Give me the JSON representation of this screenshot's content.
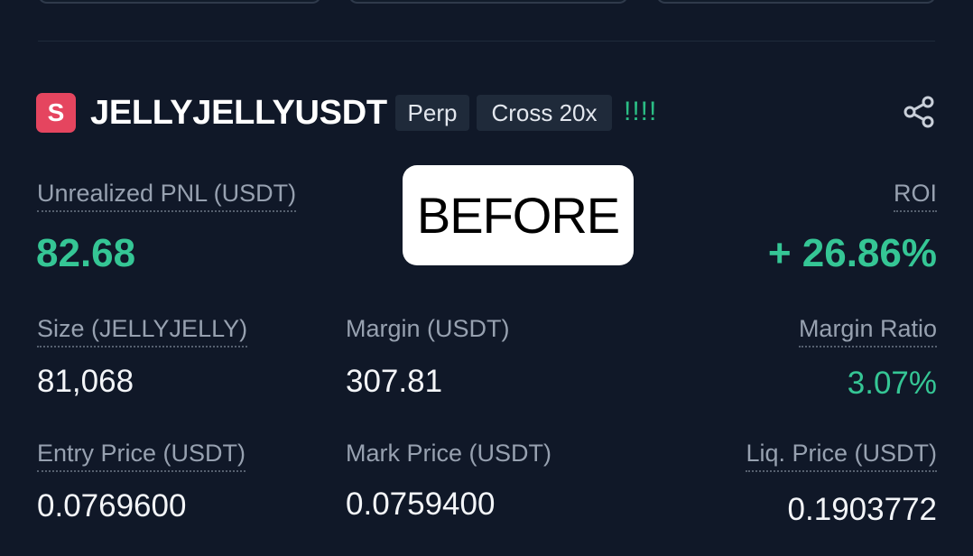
{
  "position": {
    "coin_icon_letter": "S",
    "symbol": "JELLYJELLYUSDT",
    "tags": [
      "Perp",
      "Cross 20x"
    ],
    "risk_indicator": "!!!!",
    "accent_color": "#35c695",
    "icon_color": "#e5455f"
  },
  "pnl": {
    "label": "Unrealized PNL (USDT)",
    "value": "82.68"
  },
  "roi": {
    "label": "ROI",
    "value": "+ 26.86%"
  },
  "size": {
    "label": "Size (JELLYJELLY)",
    "value": "81,068"
  },
  "margin": {
    "label": "Margin (USDT)",
    "value": "307.81"
  },
  "margin_ratio": {
    "label": "Margin Ratio",
    "value": "3.07%"
  },
  "entry_price": {
    "label": "Entry Price (USDT)",
    "value": "0.0769600"
  },
  "mark_price": {
    "label": "Mark Price (USDT)",
    "value": "0.0759400"
  },
  "liq_price": {
    "label": "Liq. Price (USDT)",
    "value": "0.1903772"
  },
  "overlay": {
    "text": "BEFORE"
  },
  "icons": {
    "share": "share-icon"
  }
}
